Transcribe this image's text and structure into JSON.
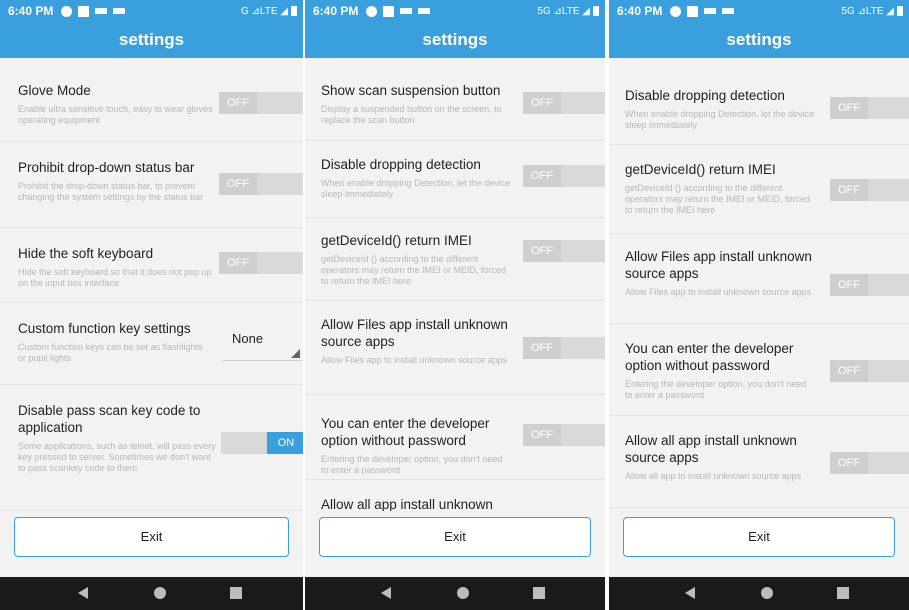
{
  "screens": [
    {
      "status": {
        "time": "6:40 PM",
        "network": "G ⊿LTE ◢"
      },
      "title": "settings",
      "items": [
        {
          "title": "Glove Mode",
          "desc": "Enable ultra sensitive touch, easy to wear gloves operating equipment",
          "toggle": "OFF"
        },
        {
          "title": "Prohibit drop-down status bar",
          "desc": "Prohibit the drop-down status bar, to prevent changing the system settings by the status bar",
          "toggle": "OFF"
        },
        {
          "title": "Hide the soft keyboard",
          "desc": "Hide the soft keyboard so that it does not pop up on the input box interface",
          "toggle": "OFF"
        },
        {
          "title": "Custom function key settings",
          "desc": "Custom function keys can be set as flashlights or pupil lights",
          "dropdown": "None"
        },
        {
          "title": "Disable pass scan key code to application",
          "desc": "Some applications, such as telnet, will pass every key pressed to server. Sometimes we don't want to pass scankey code to them",
          "toggle": "ON"
        }
      ],
      "exit_label": "Exit"
    },
    {
      "status": {
        "time": "6:40 PM",
        "network": "5G ⊿LTE ◢"
      },
      "title": "settings",
      "items": [
        {
          "title": "Show scan suspension button",
          "desc": "Display a suspended button on the screen, to replace the scan button",
          "toggle": "OFF"
        },
        {
          "title": "Disable dropping detection",
          "desc": "When enable dropping Detection, let the device sleep immediately",
          "toggle": "OFF"
        },
        {
          "title": "getDeviceId() return IMEI",
          "desc": "getDeviceId () according to the different operators may return the IMEI or MEID, forced to return the IMEI here",
          "toggle": "OFF"
        },
        {
          "title": "Allow Files app install unknown source apps",
          "desc": "Allow Files app to install unknown source apps",
          "toggle": "OFF"
        },
        {
          "title": "You can enter the developer option without password",
          "desc": "Entering the developer option, you don't need to enter a password",
          "toggle": "OFF"
        },
        {
          "title": "Allow all app install unknown"
        }
      ],
      "exit_label": "Exit"
    },
    {
      "status": {
        "time": "6:40 PM",
        "network": "5G ⊿LTE ◢"
      },
      "title": "settings",
      "items": [
        {
          "title": "Disable dropping detection",
          "desc": "When enable dropping Detection, let the device sleep immediately",
          "toggle": "OFF"
        },
        {
          "title": "getDeviceId() return IMEI",
          "desc": "getDeviceId () according to the different operators may return the IMEI or MEID, forced to return the IMEI here",
          "toggle": "OFF"
        },
        {
          "title": "Allow Files app install unknown source apps",
          "desc": "Allow Files app to install unknown source apps",
          "toggle": "OFF"
        },
        {
          "title": "You can enter the developer option without password",
          "desc": "Entering the developer option, you don't need to enter a password",
          "toggle": "OFF"
        },
        {
          "title": "Allow all app install unknown source apps",
          "desc": "Allow all app to install unknown source apps",
          "toggle": "OFF"
        }
      ],
      "exit_label": "Exit"
    }
  ],
  "icons": {
    "status": [
      "notification-circle-icon",
      "notification-grid-icon",
      "hd-icon",
      "keyboard-icon",
      "signal-icon",
      "battery-icon"
    ],
    "nav": [
      "back-icon",
      "home-icon",
      "recents-icon"
    ]
  },
  "colors": {
    "accent": "#3aa0dd",
    "background": "#f2f2f2",
    "navbar": "#1a1a1a",
    "toggle_off": "#cfcfcf"
  }
}
